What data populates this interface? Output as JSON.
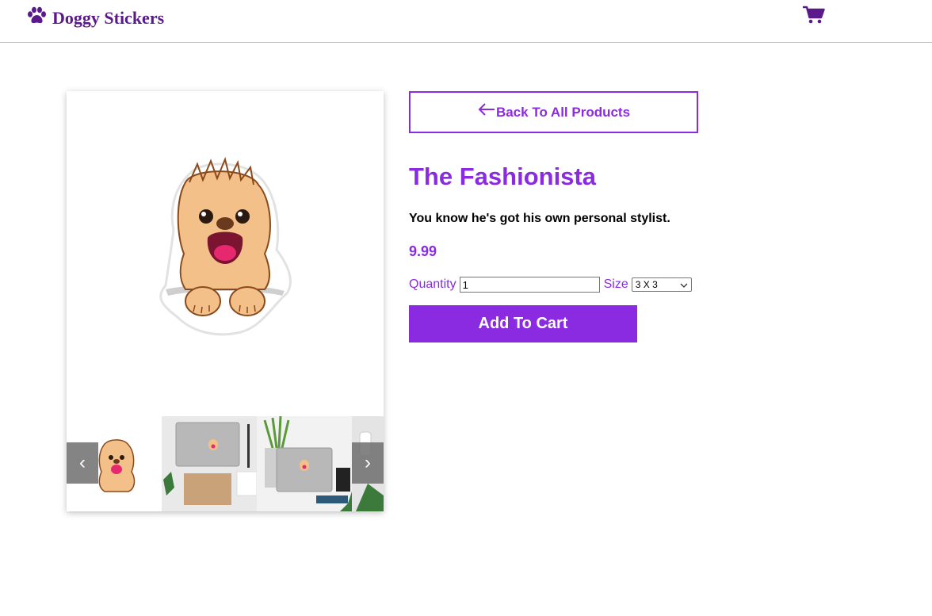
{
  "header": {
    "brand_name": "Doggy Stickers",
    "brand_icon": "paw-icon",
    "cart_icon": "shopping-cart-icon"
  },
  "gallery": {
    "main_image": "dog-sticker-illustration",
    "thumbnails": [
      "dog-sticker-thumbnail",
      "laptop-desk-mockup",
      "laptop-desk-mockup-2",
      "mockup-partial"
    ],
    "prev_arrow": "‹",
    "next_arrow": "›"
  },
  "product": {
    "back_label": "Back To All Products",
    "title": "The Fashionista",
    "description": "You know he's got his own personal stylist.",
    "price": "9.99",
    "quantity_label": "Quantity",
    "quantity_value": "1",
    "size_label": "Size",
    "size_value": "3 X 3",
    "add_to_cart_label": "Add To Cart"
  },
  "colors": {
    "accent": "#8a2be2",
    "brand": "#5b1a8c",
    "header_border": "#d4b3e6"
  }
}
